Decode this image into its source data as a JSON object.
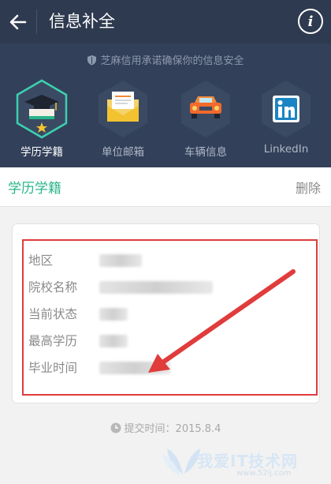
{
  "topbar": {
    "title": "信息补全",
    "back_icon": "arrow-left-icon",
    "info_icon": "info-icon"
  },
  "header": {
    "security_note": "芝麻信用承诺确保你的信息安全",
    "categories": [
      {
        "label": "学历学籍",
        "icon": "graduation-cap-icon",
        "active": true
      },
      {
        "label": "单位邮箱",
        "icon": "envelope-icon",
        "active": false
      },
      {
        "label": "车辆信息",
        "icon": "car-icon",
        "active": false
      },
      {
        "label": "LinkedIn",
        "icon": "linkedin-icon",
        "active": false
      }
    ]
  },
  "section": {
    "title": "学历学籍",
    "delete_label": "删除"
  },
  "fields": [
    {
      "label": "地区"
    },
    {
      "label": "院校名称"
    },
    {
      "label": "当前状态"
    },
    {
      "label": "最高学历"
    },
    {
      "label": "毕业时间"
    }
  ],
  "footer": {
    "submit_time": "提交时间：2015.8.4"
  },
  "watermark": {
    "text": "我爱IT技术网",
    "url": "www.52ij.com"
  },
  "colors": {
    "topbar_bg": "#2e3a4f",
    "panel_bg": "#33405a",
    "accent_green": "#2bb58a",
    "highlight_red": "#e03c3c"
  }
}
